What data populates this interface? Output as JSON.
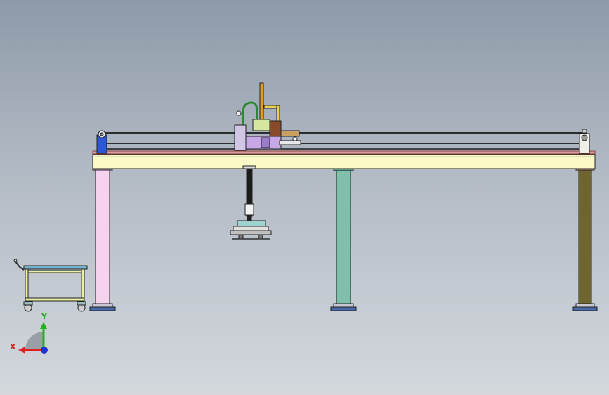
{
  "view": {
    "background_top": "#8e9aa9",
    "background_bottom": "#d4d8dd"
  },
  "model": {
    "name": "",
    "parts": {
      "main_beam": "main-beam",
      "leg_left": "leg-left",
      "leg_middle": "leg-middle",
      "leg_right": "leg-right",
      "carriage": "carriage-assembly",
      "gripper": "vacuum-gripper",
      "cart": "material-cart"
    },
    "colors": {
      "beam": "#fbf9c6",
      "leg_left": "#f5d2ee",
      "leg_middle": "#7fbfab",
      "leg_right": "#6e6531",
      "carriage": "#c7a7e6",
      "rail": "#000000",
      "accent_orange": "#e39a1d",
      "accent_blue": "#2b58d8",
      "cart_frame": "#e9efa0",
      "cart_top": "#74b3c9"
    }
  },
  "triad": {
    "x_label": "X",
    "y_label": "Y",
    "x_color": "#e02020",
    "y_color": "#22b022",
    "z_color": "#1a35d0"
  }
}
